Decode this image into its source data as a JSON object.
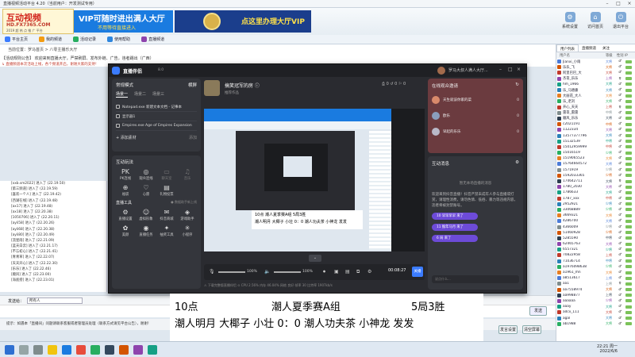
{
  "window": {
    "title": "直播视频活动平台 4.20（当前用户：开发测试专用）"
  },
  "banner": {
    "logo_title": "互动视频",
    "logo_url": "HD.FX7365.COM",
    "logo_slogan": "2019 超 热 点 推 广 平台",
    "ad1_main": "VIP可随时进出满人大厅",
    "ad1_sub": "不用等待直接进入",
    "ad2_text": "点这里办理大厅VIP",
    "top_icons": [
      {
        "label": "系统设置",
        "icon": "gear-icon"
      },
      {
        "label": "访问首页",
        "icon": "home-icon"
      },
      {
        "label": "退出平台",
        "icon": "exit-icon"
      }
    ]
  },
  "nav": {
    "items": [
      {
        "label": "平台主页",
        "color": "#3b7cff"
      },
      {
        "label": "我的频道",
        "color": "#f39c12"
      },
      {
        "label": "活动记录",
        "color": "#27ae60"
      },
      {
        "label": "使用帮助",
        "color": "#2e86de"
      },
      {
        "label": "直播频道",
        "color": "#8e44ad"
      }
    ]
  },
  "room": {
    "line1": "当前位置：罗马首页 > 八零主播乐大厅",
    "line2": "【活动规则公告】 欢迎来到直播大厅，严禁刷屏、发布外链、广告，违者踢出（广西）",
    "line3": "↳ 请您遵守规则发言，活动期间：",
    "warning": "↳ 直播频道本次活动上线，各个频道开启，谢谢大家的支持！"
  },
  "chatlog": [
    "[xxb.sm2022] 进入了 (22.19.50)",
    "[第三频道] 进入了 (22.19.59)",
    "[喜欢一个人] 进入了 (22.19.42)",
    "[西湖在线] 进入了 (22.19.48)",
    "[ax17] 进入了 (22.19.48)",
    "[ax18] 进入了 (22.20.38)",
    "[1050706] 进入了 (22.20.11)",
    "[ayli58] 进入了 (22.20.26)",
    "[ayli68] 进入了 (22.20.38)",
    "[ayli80] 进入了 (22.20.49)",
    "[流星雨] 进入了 (22.21.09)",
    "[蓝天白云] 进入了 (22.21.17)",
    "[不忘初心] 进入了 (22.21.41)",
    "[青青草] 进入了 (22.22.07)",
    "[天天开心] 进入了 (22.22.30)",
    "[乐乐] 进入了 (22.22.46)",
    "[顺风] 进入了 (22.23.00)",
    "[海底捞] 进入了 (22.23.01)"
  ],
  "input": {
    "label": "发送给：",
    "target": "所有人",
    "send": "发送",
    "tip": "提示：如遇本「直播间」问题请联系客服或者管理员处理（联系方式请见平台公告），谢谢！",
    "btn_settings": "发言设置",
    "btn_clear": "清空屏幕"
  },
  "userlist": {
    "tabs": [
      "用户列表",
      "直播频道",
      "关注"
    ],
    "headers": [
      "用户名",
      "等级",
      "性别",
      "IP"
    ],
    "users": [
      {
        "name": "Jianxi_小雨",
        "rank": "大将",
        "sex": "♂",
        "color": "#4a7bd8"
      },
      {
        "name": "乐乐_飞",
        "rank": "大将",
        "sex": "♂",
        "color": "#d35400"
      },
      {
        "name": "阿里巴巴_大",
        "rank": "大将",
        "sex": "♂",
        "color": "#c0392b"
      },
      {
        "name": "杰哥_乐乐",
        "rank": "上将",
        "sex": "♀",
        "color": "#8e44ad"
      },
      {
        "name": "hm_1966",
        "rank": "大将",
        "sex": "♂",
        "color": "#16a085"
      },
      {
        "name": "乐_马德康",
        "rank": "大将",
        "sex": "♂",
        "color": "#2980b9"
      },
      {
        "name": "大丽花_大人",
        "rank": "大将",
        "sex": "♂",
        "color": "#e67e22"
      },
      {
        "name": "乐_老刘",
        "rank": "大将",
        "sex": "♂",
        "color": "#27ae60"
      },
      {
        "name": "开心_天天",
        "rank": "上将",
        "sex": "♀",
        "color": "#c0392b"
      },
      {
        "name": "雷哥_雷雷",
        "rank": "中将",
        "sex": "♂",
        "color": "#7f8c8d"
      },
      {
        "name": "顺风_乐乐",
        "rank": "大将",
        "sex": "♂",
        "color": "#2c3e50"
      },
      {
        "name": "c2021191",
        "rank": "中将",
        "sex": "♂",
        "color": "#d35400"
      },
      {
        "name": "1122334",
        "rank": "大将",
        "sex": "♂",
        "color": "#8e44ad"
      },
      {
        "name": "13577377796",
        "rank": "大将",
        "sex": "♂",
        "color": "#2980b9"
      },
      {
        "name": "15132539",
        "rank": "中将",
        "sex": "♂",
        "color": "#16a085"
      },
      {
        "name": "15012959999",
        "rank": "中将",
        "sex": "♂",
        "color": "#c0392b"
      },
      {
        "name": "15016519",
        "rank": "少将",
        "sex": "♂",
        "color": "#27ae60"
      },
      {
        "name": "1519065523",
        "rank": "大将",
        "sex": "♂",
        "color": "#e67e22"
      },
      {
        "name": "15764664572",
        "rank": "大将",
        "sex": "♂",
        "color": "#4a7bd8"
      },
      {
        "name": "1571919",
        "rank": "少将",
        "sex": "♂",
        "color": "#7f8c8d"
      },
      {
        "name": "1592033365",
        "rank": "少将",
        "sex": "♂",
        "color": "#d35400"
      },
      {
        "name": "174642711",
        "rank": "大将",
        "sex": "♀",
        "color": "#2c3e50"
      },
      {
        "name": "1780_2030",
        "rank": "大将",
        "sex": "♂",
        "color": "#8e44ad"
      },
      {
        "name": "1786633",
        "rank": "大将",
        "sex": "♂",
        "color": "#16a085"
      },
      {
        "name": "1787_xxx",
        "rank": "中将",
        "sex": "♂",
        "color": "#c0392b"
      },
      {
        "name": "2952921",
        "rank": "少将",
        "sex": "♂",
        "color": "#2980b9"
      },
      {
        "name": "33068889",
        "rank": "少将",
        "sex": "♂",
        "color": "#27ae60"
      },
      {
        "name": "3669321",
        "rank": "大将",
        "sex": "♂",
        "color": "#e67e22"
      },
      {
        "name": "4286700",
        "rank": "大将",
        "sex": "♂",
        "color": "#4a7bd8"
      },
      {
        "name": "4366009",
        "rank": "少将",
        "sex": "♂",
        "color": "#7f8c8d"
      },
      {
        "name": "51460928",
        "rank": "少将",
        "sex": "♂",
        "color": "#d35400"
      },
      {
        "name": "5285590",
        "rank": "中将",
        "sex": "♂",
        "color": "#2c3e50"
      },
      {
        "name": "62465763",
        "rank": "大将",
        "sex": "♂",
        "color": "#8e44ad"
      },
      {
        "name": "6557321",
        "rank": "少将",
        "sex": "♂",
        "color": "#16a085"
      },
      {
        "name": "70822958",
        "rank": "上将",
        "sex": "♂",
        "color": "#c0392b"
      },
      {
        "name": "71036714",
        "rank": "中将",
        "sex": "♂",
        "color": "#2980b9"
      },
      {
        "name": "a1976098638",
        "rank": "少将",
        "sex": "♂",
        "color": "#27ae60"
      },
      {
        "name": "a1961_mn",
        "rank": "大将",
        "sex": "♂",
        "color": "#e67e22"
      },
      {
        "name": "a8513617",
        "rank": "上将",
        "sex": "♂",
        "color": "#4a7bd8"
      },
      {
        "name": "aa1",
        "rank": "上将",
        "sex": "♀",
        "color": "#7f8c8d"
      },
      {
        "name": "aa7558974",
        "rank": "大将",
        "sex": "♂",
        "color": "#d35400"
      },
      {
        "name": "aa998877",
        "rank": "上将",
        "sex": "♂",
        "color": "#2c3e50"
      },
      {
        "name": "aaaaaa",
        "rank": "少将",
        "sex": "♂",
        "color": "#8e44ad"
      },
      {
        "name": "aaay",
        "rank": "大将",
        "sex": "♂",
        "color": "#16a085"
      },
      {
        "name": "adcx_111",
        "rank": "大将",
        "sex": "♂",
        "color": "#c0392b"
      },
      {
        "name": "agal",
        "rank": "大将",
        "sex": "♂",
        "color": "#2980b9"
      },
      {
        "name": "ab1988",
        "rank": "大将",
        "sex": "♂",
        "color": "#27ae60"
      }
    ]
  },
  "taskbar": {
    "time": "22:21 周一",
    "date": "2022/6/6"
  },
  "stream": {
    "app_name": "直播伴侣",
    "version": "8.0",
    "user_name": "罗马大叔人满人大厅...",
    "scenes_title": "常规模式",
    "scenes_btn": "横屏",
    "scene_tabs": [
      "场景一",
      "场景二",
      "场景三"
    ],
    "sources": [
      "Notepad.exe 新建文本文档 - 记事本",
      "显示器1",
      "Empires.exe Age of Empires Expansion"
    ],
    "add_source": "添加素材",
    "add_source_hint": "添加",
    "tools_title": "互动玩法",
    "tools_row1": [
      {
        "label": "PK连线",
        "glyph": "PK",
        "dim": false
      },
      {
        "label": "观众连线",
        "glyph": "◎",
        "dim": false
      },
      {
        "label": "聊天室",
        "glyph": "▭",
        "dim": true
      },
      {
        "label": "音乐",
        "glyph": "♫",
        "dim": true
      }
    ],
    "tools_row2": [
      {
        "label": "福袋",
        "glyph": "⊕",
        "dim": false
      },
      {
        "label": "心愿",
        "glyph": "♡",
        "dim": false
      },
      {
        "label": "礼物投票",
        "glyph": "▤",
        "dim": false
      }
    ],
    "tools2_title": "直播工具",
    "tools2_hint": "● 数据助手新上线",
    "tools_row3": [
      {
        "label": "直播设置",
        "glyph": "⚙",
        "dim": false
      },
      {
        "label": "虚拟形象",
        "glyph": "☺",
        "dim": false
      },
      {
        "label": "抖音商城",
        "glyph": "✉",
        "dim": false
      },
      {
        "label": "游戏助手",
        "glyph": "◈",
        "dim": false
      }
    ],
    "tools_row4": [
      {
        "label": "美颜",
        "glyph": "✿",
        "dim": false
      },
      {
        "label": "直播任务",
        "glyph": "◉",
        "dim": false
      },
      {
        "label": "抽奖工具",
        "glyph": "✦",
        "dim": false
      },
      {
        "label": "小程序",
        "glyph": "✳",
        "dim": false
      }
    ],
    "channel_title": "搞笑冠军的房 ⓘ",
    "channel_sub": "推荐作品",
    "channel_stats": "⎙ 0  ↺ 0  ⚐ 0",
    "preview_caption_l1": "10点   潮人夏季赛A组   5局3胜",
    "preview_caption_l2": "潮人明月 大椰子 小壮 0：0 潮人功夫茶 小神龙 发发",
    "volume_mic": "100%",
    "volume_sys": "100%",
    "timer": "00:08:27",
    "stop_label": "关播",
    "status": "⚠ 下载完整版直播伴侣    ⊙ CPU 2.56%  内存 46.04%  网络 良好  帧率 30  比特率 1907kb/s",
    "invite_title": "在线观众邀请",
    "invite_users": [
      {
        "name": "天生就该你家的菜",
        "count": "0",
        "color": "#d98a6b"
      },
      {
        "name": "欧乐",
        "count": "0",
        "color": "#8a9ebc"
      },
      {
        "name": "早起的乐乐",
        "count": "0",
        "color": "#b9b9c8"
      }
    ],
    "messages_title": "互动消息",
    "messages_empty": "暂无本场直播的消息",
    "system_msg": "欢迎来到抖音直播！抖音严禁未成年人参与直播或打赏，请理性消费，请勿色情、低俗、暴力等违规内容，违者将被封禁账号。",
    "pills": [
      "10 早早早早 来了",
      "11 猴年马月 来了",
      "6 局 来了"
    ],
    "input_placeholder": "说点什么..."
  },
  "caption": {
    "time": "10点",
    "group": "潮人夏季赛A组",
    "format": "5局3胜",
    "teams": "潮人明月 大椰子 小壮 0：0 潮人功夫茶 小神龙 发发"
  }
}
